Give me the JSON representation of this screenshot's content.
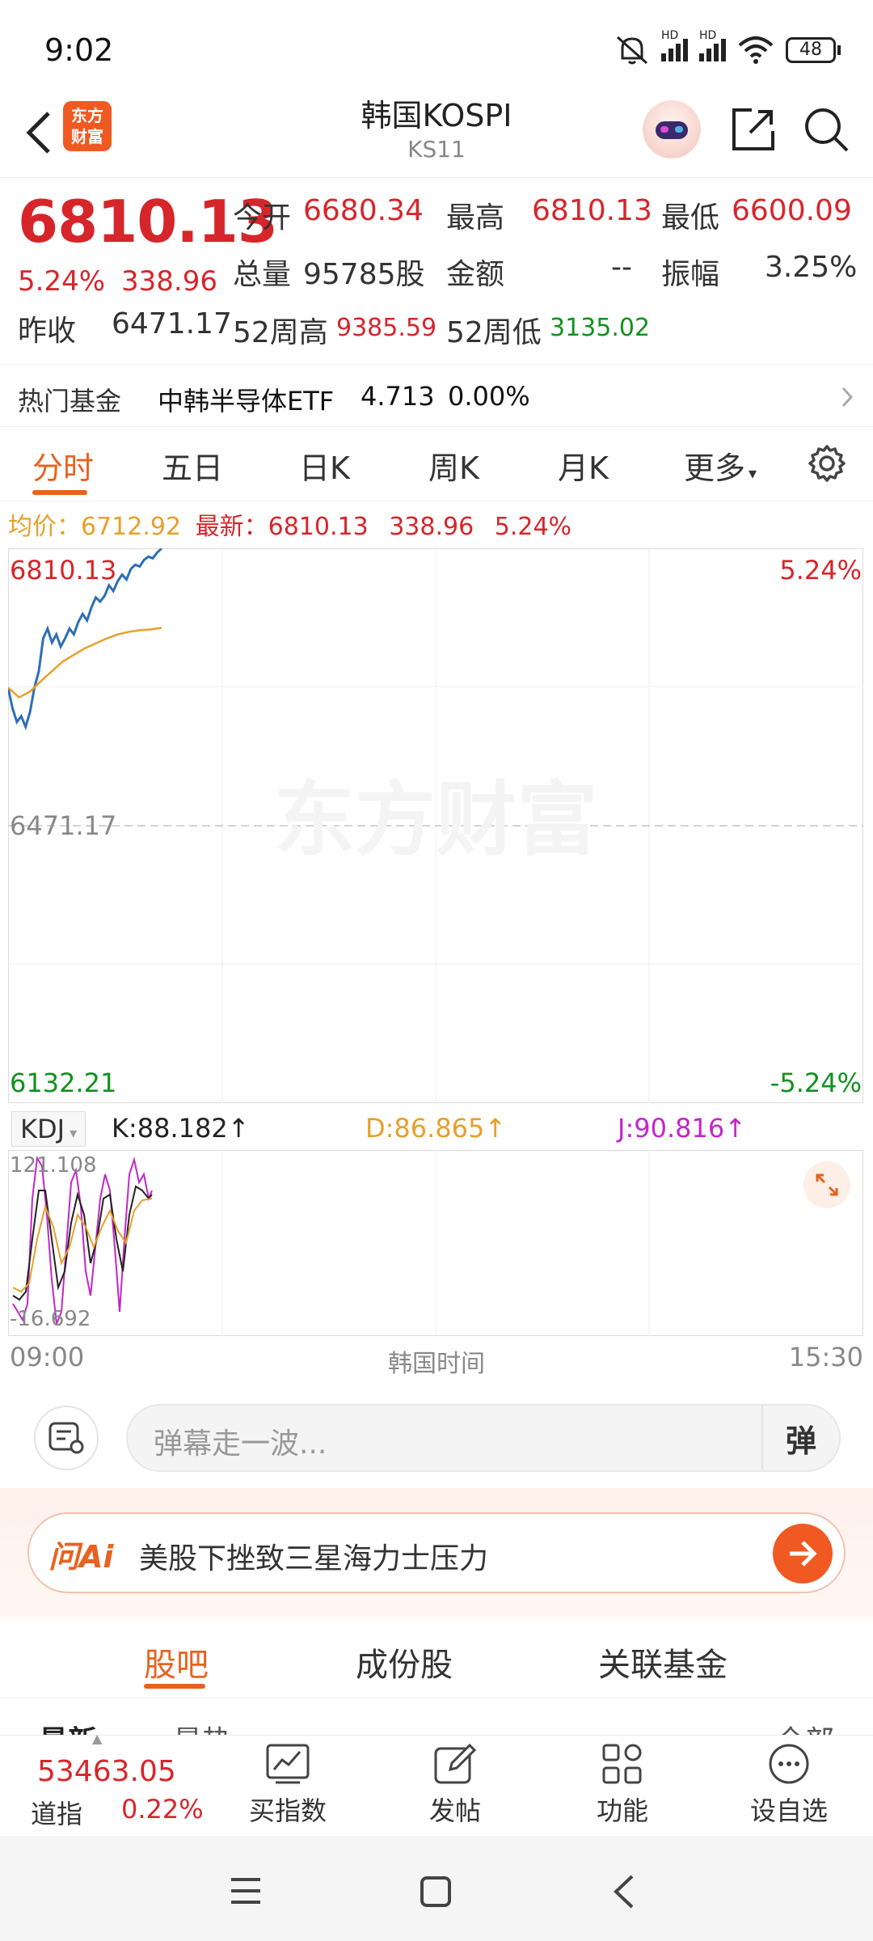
{
  "status": {
    "time": "9:02",
    "battery": "48",
    "hd1": "HD",
    "hd2": "HD"
  },
  "header": {
    "title": "韩国KOSPI",
    "subtitle": "KS11",
    "logo_line1": "东方",
    "logo_line2": "财富"
  },
  "quote": {
    "price": "6810.13",
    "change_pct": "5.24%",
    "change_amt": "338.96",
    "prev_close_label": "昨收",
    "prev_close": "6471.17",
    "open_label": "今开",
    "open": "6680.34",
    "high_label": "最高",
    "high": "6810.13",
    "low_label": "最低",
    "low": "6600.09",
    "volume_label": "总量",
    "volume": "95785股",
    "amount_label": "金额",
    "amount": "--",
    "amplitude_label": "振幅",
    "amplitude": "3.25%",
    "w52_high_label": "52周高",
    "w52_high": "9385.59",
    "w52_low_label": "52周低",
    "w52_low": "3135.02"
  },
  "hotfund": {
    "label": "热门基金",
    "name": "中韩半导体ETF",
    "price": "4.713",
    "change": "0.00%"
  },
  "tabs": [
    "分时",
    "五日",
    "日K",
    "周K",
    "月K",
    "更多"
  ],
  "info_line": {
    "avg_label": "均价：",
    "avg": "6712.92",
    "latest_label": "最新：",
    "latest": "6810.13",
    "chg": "338.96",
    "pct": "5.24%"
  },
  "chart_labels": {
    "top_left": "6810.13",
    "top_right": "5.24%",
    "mid": "6471.17",
    "bottom_left": "6132.21",
    "bottom_right": "-5.24%",
    "watermark": "东方财富"
  },
  "kdj": {
    "selector": "KDJ",
    "k": "K:88.182",
    "d": "D:86.865",
    "j": "J:90.816",
    "max": "121.108",
    "min": "-16.692"
  },
  "time_axis": {
    "start": "09:00",
    "mid": "韩国时间",
    "end": "15:30"
  },
  "danmaku": {
    "placeholder": "弹幕走一波...",
    "toggle": "弹"
  },
  "ai": {
    "logo": "问Ai",
    "text": "美股下挫致三星海力士压力"
  },
  "section_tabs": [
    "股吧",
    "成份股",
    "关联基金"
  ],
  "peek": {
    "left1": "最新",
    "left2": "最热",
    "right": "全部"
  },
  "toolbar": {
    "ticker_price": "53463.05",
    "ticker_name": "道指",
    "ticker_pct": "0.22%",
    "buy_index": "买指数",
    "post": "发帖",
    "functions": "功能",
    "add_watch": "设自选"
  },
  "chart_data": {
    "type": "line",
    "x_range": [
      "09:00",
      "15:30"
    ],
    "ylim": [
      6132.21,
      6810.13
    ],
    "series": [
      {
        "name": "最新",
        "color": "#2c6fb7",
        "x": [
          0,
          2,
          4,
          6,
          8,
          10,
          12,
          14,
          16,
          18,
          20,
          22,
          24,
          26,
          28,
          30,
          32,
          34,
          36,
          38,
          40,
          42,
          44,
          46,
          48,
          50,
          52,
          54,
          56,
          58,
          60,
          62,
          64,
          66,
          68,
          70
        ],
        "values": [
          6640,
          6615,
          6598,
          6605,
          6592,
          6610,
          6640,
          6660,
          6700,
          6712,
          6695,
          6705,
          6690,
          6700,
          6712,
          6705,
          6720,
          6730,
          6722,
          6738,
          6750,
          6745,
          6752,
          6765,
          6758,
          6770,
          6778,
          6772,
          6785,
          6790,
          6788,
          6796,
          6800,
          6798,
          6805,
          6810.13
        ]
      },
      {
        "name": "均价",
        "color": "#e7a02a",
        "x": [
          0,
          5,
          10,
          15,
          20,
          25,
          30,
          35,
          40,
          45,
          50,
          55,
          60,
          65,
          70
        ],
        "values": [
          6640,
          6628,
          6635,
          6648,
          6660,
          6672,
          6680,
          6688,
          6694,
          6700,
          6705,
          6708,
          6710,
          6711,
          6712.92
        ]
      }
    ]
  }
}
